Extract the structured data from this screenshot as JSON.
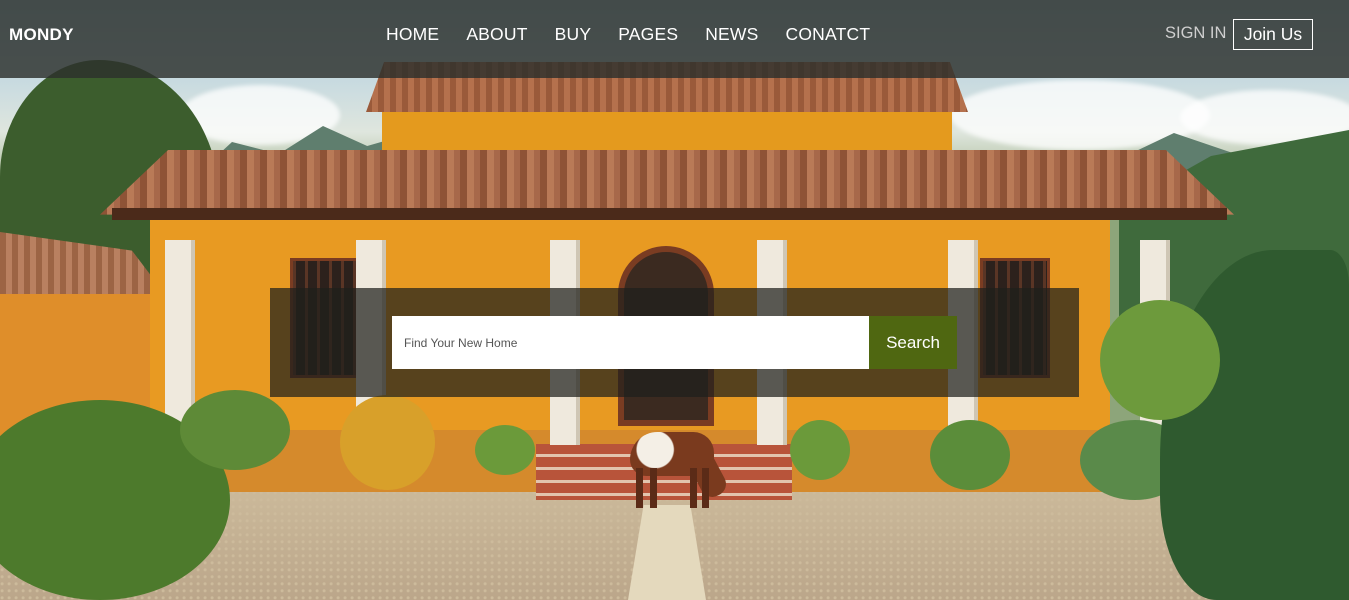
{
  "brand": {
    "logo": "MONDY"
  },
  "nav": {
    "items": [
      {
        "label": "HOME"
      },
      {
        "label": "ABOUT"
      },
      {
        "label": "BUY"
      },
      {
        "label": "PAGES"
      },
      {
        "label": "NEWS"
      },
      {
        "label": "CONATCT"
      }
    ]
  },
  "auth": {
    "sign_in_label": "SIGN IN",
    "join_label": "Join Us"
  },
  "search": {
    "placeholder": "Find Your New Home",
    "button_label": "Search"
  },
  "colors": {
    "accent": "#4f6711",
    "topbar": "#2c302c"
  }
}
